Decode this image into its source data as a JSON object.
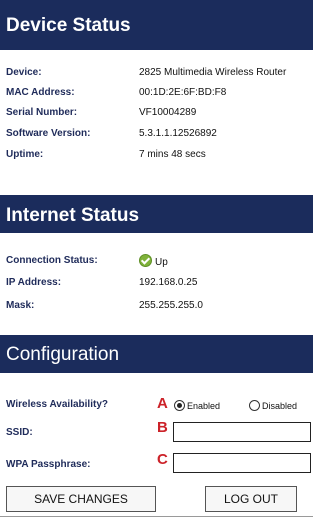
{
  "device_status": {
    "title": "Device Status",
    "rows": [
      {
        "label": "Device:",
        "value": "2825 Multimedia Wireless Router"
      },
      {
        "label": "MAC Address:",
        "value": "00:1D:2E:6F:BD:F8"
      },
      {
        "label": "Serial Number:",
        "value": "VF10004289"
      },
      {
        "label": "Software Version:",
        "value": "5.3.1.1.12526892"
      },
      {
        "label": "Uptime:",
        "value": "7 mins 48 secs"
      }
    ]
  },
  "internet_status": {
    "title": "Internet Status",
    "rows": [
      {
        "label": "Connection Status:",
        "value": "Up",
        "icon": "check-circle-icon",
        "icon_color": "#7fb23a"
      },
      {
        "label": "IP Address:",
        "value": "192.168.0.25"
      },
      {
        "label": "Mask:",
        "value": "255.255.255.0"
      }
    ]
  },
  "configuration": {
    "title": "Configuration",
    "wireless": {
      "label": "Wireless Availability?",
      "marker": "A",
      "options": [
        {
          "label": "Enabled",
          "selected": true
        },
        {
          "label": "Disabled",
          "selected": false
        }
      ]
    },
    "ssid": {
      "label": "SSID:",
      "marker": "B",
      "value": ""
    },
    "passphrase": {
      "label": "WPA Passphrase:",
      "marker": "C",
      "value": ""
    }
  },
  "buttons": {
    "save": "SAVE CHANGES",
    "logout": "LOG OUT"
  },
  "colors": {
    "header_bg": "#1b2c5c",
    "label_text": "#1f2b5a",
    "marker": "#cc2229"
  }
}
